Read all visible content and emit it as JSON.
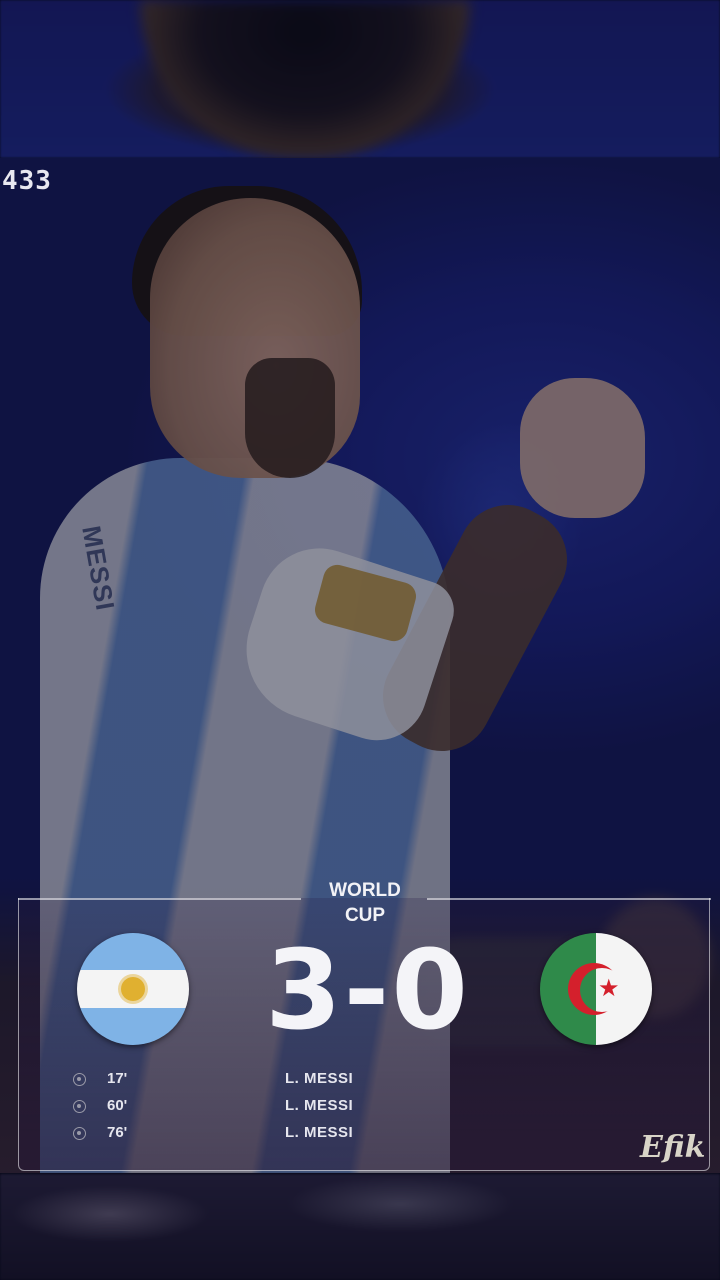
{
  "watermark": "433",
  "competition": "WORLD\nCUP",
  "match": {
    "home_team_flag": "argentina-flag",
    "away_team_flag": "algeria-flag",
    "home_score": "3",
    "separator": "-",
    "away_score": "0",
    "score_text": "3-0"
  },
  "goals": [
    {
      "minute": "17'",
      "scorer": "L. MESSI"
    },
    {
      "minute": "60'",
      "scorer": "L. MESSI"
    },
    {
      "minute": "76'",
      "scorer": "L. MESSI"
    }
  ],
  "jersey_name": "MESSI",
  "signature": "Efik",
  "colors": {
    "background_blue": "#1a2380",
    "argentina_blue": "#7fb3e6",
    "algeria_green": "#2f8a4a",
    "algeria_red": "#d4202c"
  }
}
